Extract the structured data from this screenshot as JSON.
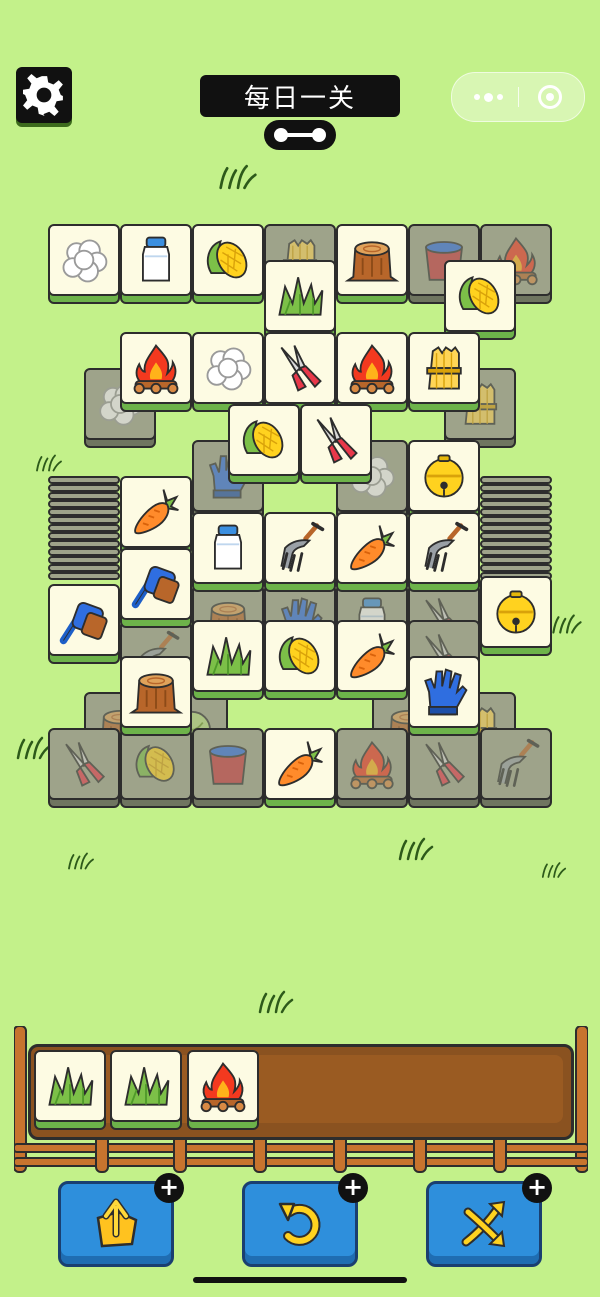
{
  "header": {
    "title": "每日一关",
    "settings_icon": "gear-icon",
    "tag_icon": "dumbbell-icon",
    "menu_icon": "more-dots-icon",
    "close_icon": "target-close-icon"
  },
  "colors": {
    "background": "#c3f18a",
    "tile_face": "#fdfbe3",
    "tile_base": "#6db34a",
    "tray": "#8a5220",
    "button": "#2e8fdc"
  },
  "board": {
    "top_tiles": [
      "cotton",
      "milk-jar",
      "corn",
      "grass",
      "stump",
      "corn",
      "campfire",
      "cotton",
      "shears",
      "campfire",
      "wheat",
      "corn",
      "shears",
      "bell",
      "carrot",
      "milk-jar",
      "pitchfork",
      "carrot",
      "pitchfork",
      "brush",
      "brush",
      "bell",
      "grass",
      "corn",
      "carrot",
      "stump",
      "glove",
      "carrot"
    ],
    "buried_tiles": [
      "wheat",
      "bucket",
      "campfire",
      "glove",
      "wheat",
      "cotton",
      "wheat",
      "glove",
      "shears",
      "stump",
      "bucket",
      "stump",
      "campfire",
      "shears",
      "pitchfork",
      "lettuce",
      "grass"
    ]
  },
  "tray": {
    "capacity": 7,
    "items": [
      "grass",
      "grass",
      "campfire"
    ]
  },
  "tools": [
    {
      "name": "move-out",
      "icon": "box-arrow-up-icon",
      "badge": "+"
    },
    {
      "name": "undo",
      "icon": "undo-arrow-icon",
      "badge": "+"
    },
    {
      "name": "shuffle",
      "icon": "shuffle-icon",
      "badge": "+"
    }
  ]
}
